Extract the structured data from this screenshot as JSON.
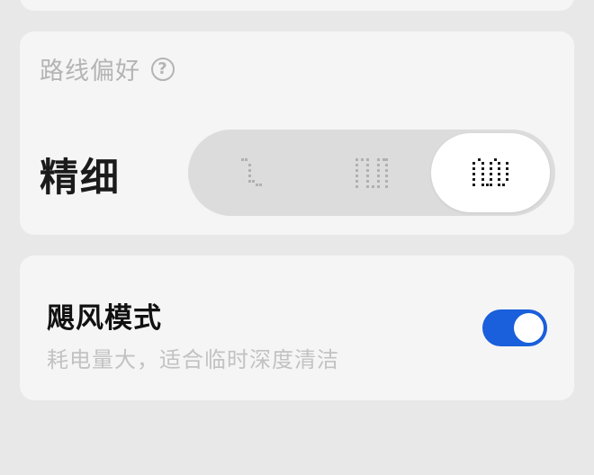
{
  "route_preference": {
    "title": "路线偏好",
    "help_glyph": "?",
    "current_label": "精细",
    "options": [
      {
        "icon": "route-sparse-icon",
        "selected": false
      },
      {
        "icon": "route-standard-icon",
        "selected": false
      },
      {
        "icon": "route-fine-icon",
        "selected": true
      }
    ]
  },
  "typhoon_mode": {
    "title": "飓风模式",
    "description": "耗电量大，适合临时深度清洁",
    "enabled": true
  },
  "colors": {
    "accent": "#1a5fdb",
    "card": "#f5f5f5",
    "background": "#e8e8e8"
  }
}
